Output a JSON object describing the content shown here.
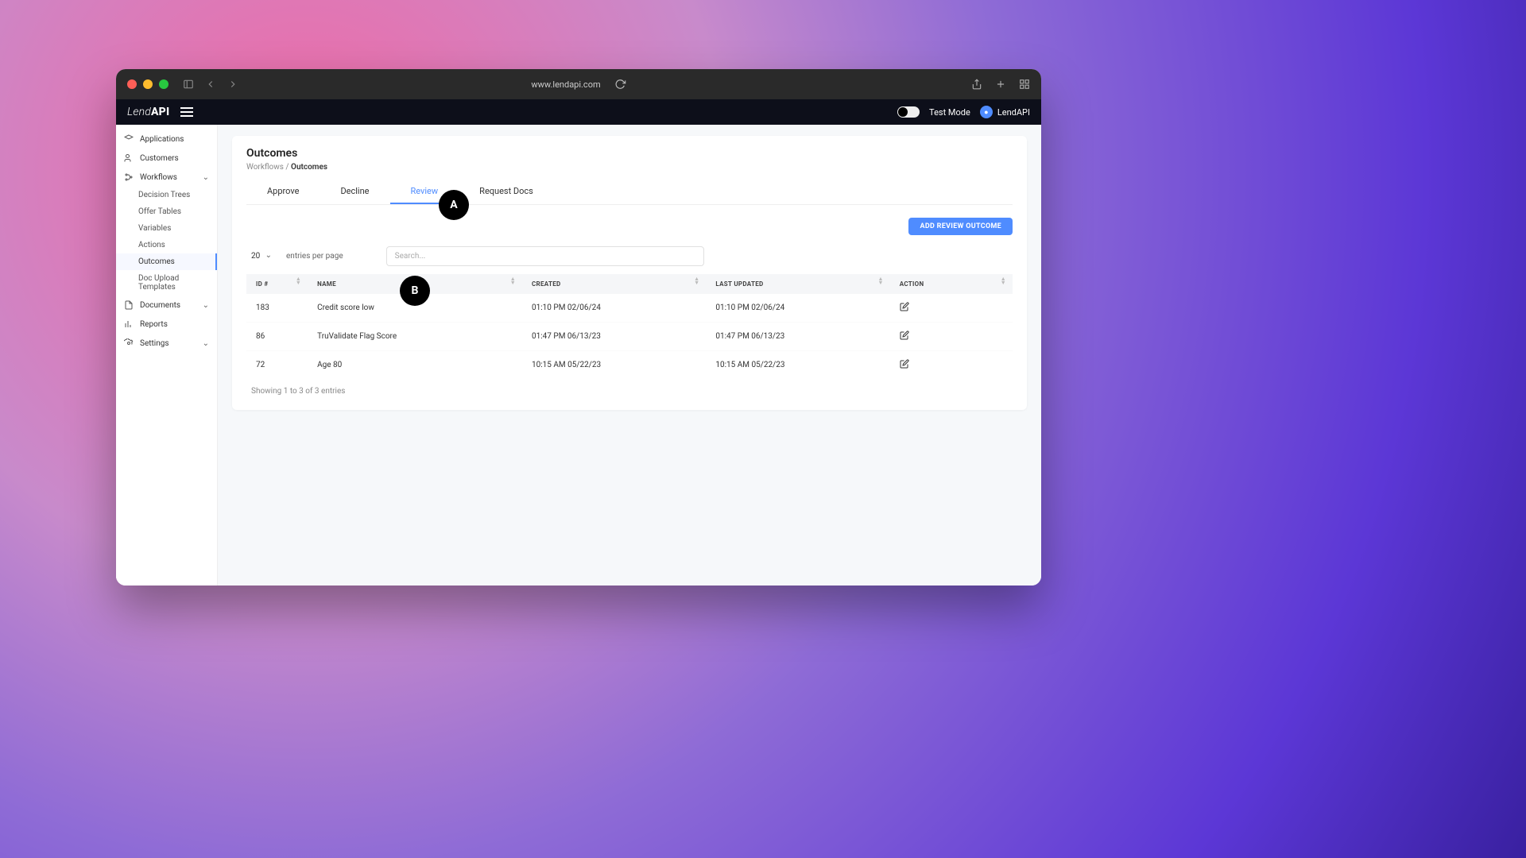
{
  "browser": {
    "url": "www.lendapi.com"
  },
  "brand": {
    "light": "Lend",
    "bold": "API"
  },
  "header": {
    "mode_label": "Test Mode",
    "user_label": "LendAPI",
    "avatar_glyph": "●"
  },
  "sidebar": {
    "items": [
      {
        "label": "Applications",
        "key": "applications",
        "icon": "layers"
      },
      {
        "label": "Customers",
        "key": "customers",
        "icon": "users"
      },
      {
        "label": "Workflows",
        "key": "workflows",
        "icon": "branch",
        "expandable": true,
        "children": [
          {
            "label": "Decision Trees",
            "key": "decision-trees"
          },
          {
            "label": "Offer Tables",
            "key": "offer-tables"
          },
          {
            "label": "Variables",
            "key": "variables"
          },
          {
            "label": "Actions",
            "key": "actions"
          },
          {
            "label": "Outcomes",
            "key": "outcomes",
            "active": true
          },
          {
            "label": "Doc Upload Templates",
            "key": "doc-upload-templates"
          }
        ]
      },
      {
        "label": "Documents",
        "key": "documents",
        "icon": "file",
        "expandable": true
      },
      {
        "label": "Reports",
        "key": "reports",
        "icon": "chart"
      },
      {
        "label": "Settings",
        "key": "settings",
        "icon": "gear",
        "expandable": true
      }
    ]
  },
  "page": {
    "title": "Outcomes",
    "breadcrumb_parent": "Workflows",
    "breadcrumb_sep": " / ",
    "breadcrumb_current": "Outcomes",
    "tabs": [
      {
        "label": "Approve",
        "active": false
      },
      {
        "label": "Decline",
        "active": false
      },
      {
        "label": "Review",
        "active": true
      },
      {
        "label": "Request Docs",
        "active": false
      }
    ],
    "add_button": "ADD REVIEW OUTCOME"
  },
  "table": {
    "page_size_value": "20",
    "page_size_suffix": "entries per page",
    "search_placeholder": "Search...",
    "columns": [
      "ID #",
      "NAME",
      "CREATED",
      "LAST UPDATED",
      "ACTION"
    ],
    "rows": [
      {
        "id": "183",
        "name": "Credit score low",
        "created": "01:10 PM 02/06/24",
        "updated": "01:10 PM 02/06/24"
      },
      {
        "id": "86",
        "name": "TruValidate Flag Score",
        "created": "01:47 PM 06/13/23",
        "updated": "01:47 PM 06/13/23"
      },
      {
        "id": "72",
        "name": "Age 80",
        "created": "10:15 AM 05/22/23",
        "updated": "10:15 AM 05/22/23"
      }
    ],
    "footer": "Showing 1 to 3 of 3 entries"
  },
  "annotations": {
    "a": "A",
    "b": "B"
  }
}
